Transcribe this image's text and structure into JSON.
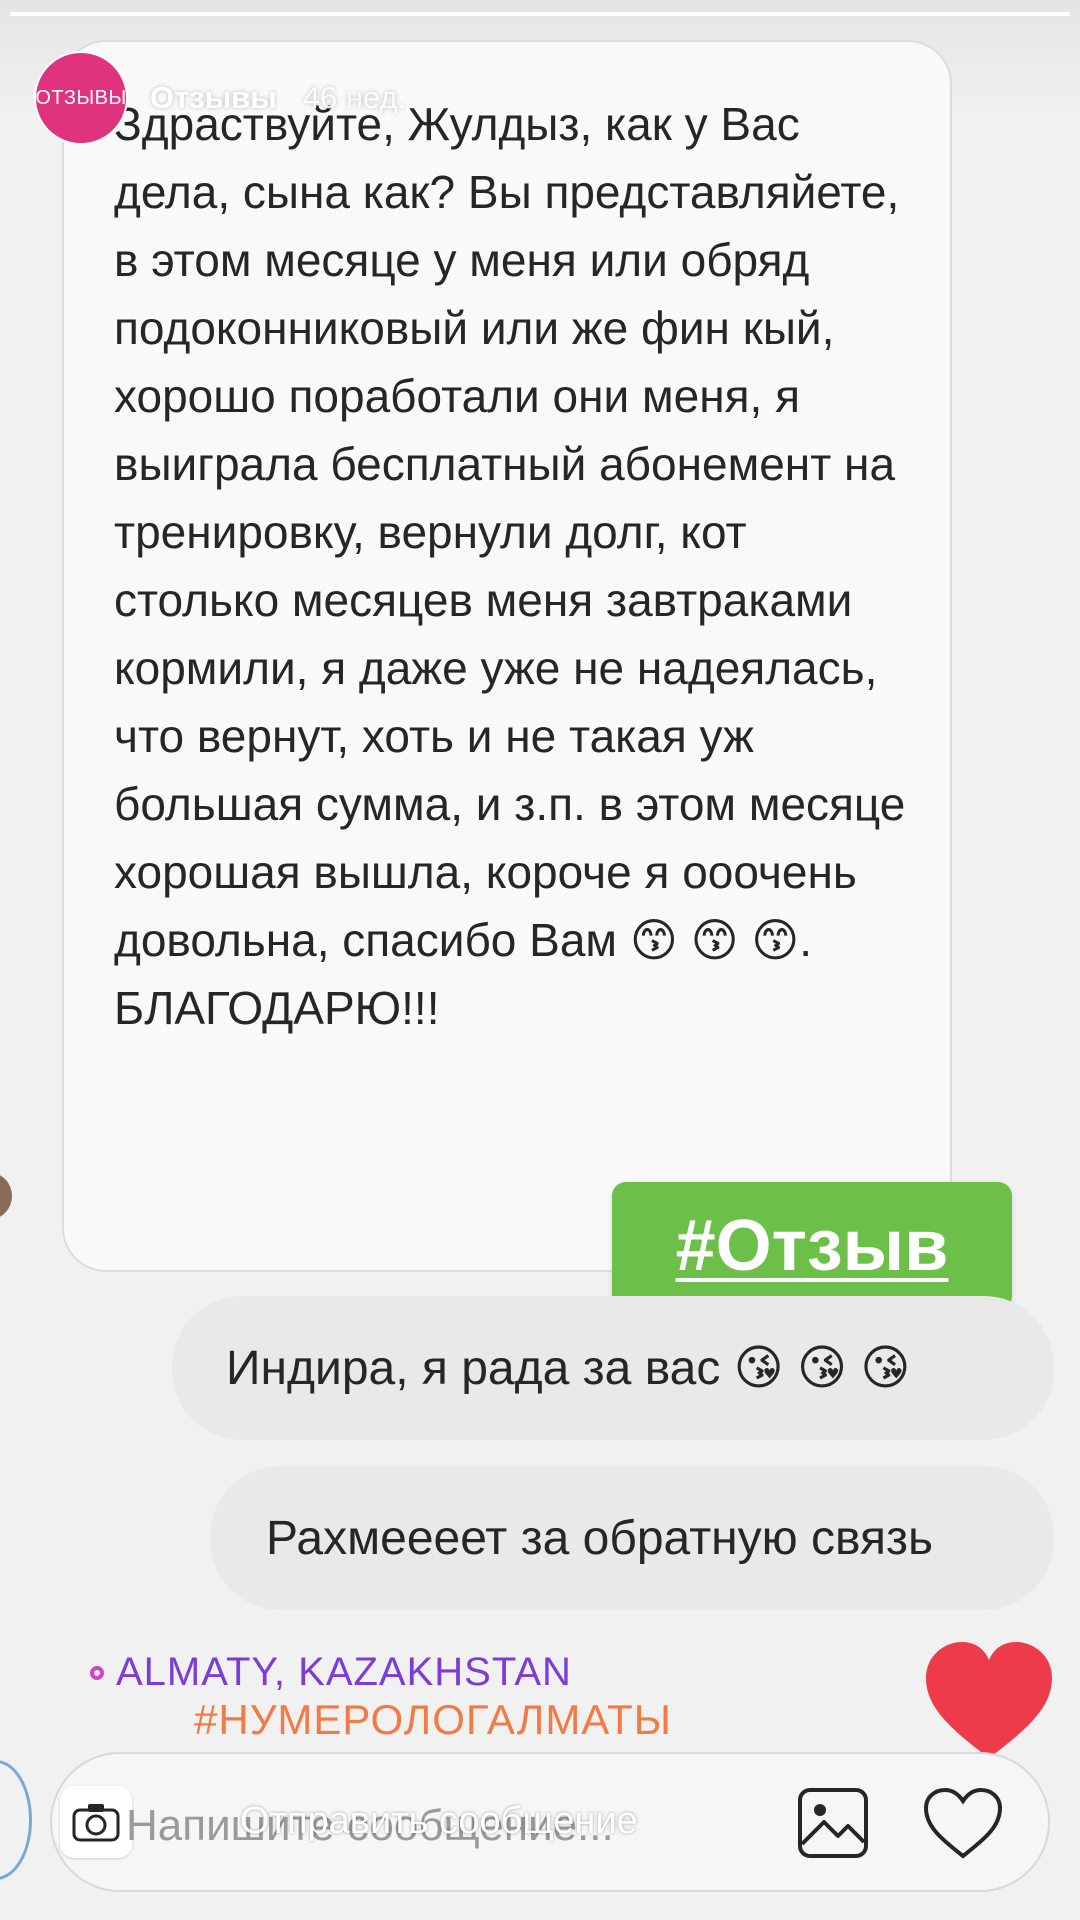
{
  "story": {
    "username": "Отзывы",
    "timestamp": "46 нед.",
    "avatar_label": "ОТЗЫВЫ",
    "progress": 1.0
  },
  "conversation": {
    "received_message": "Здраствуйте, Жулдыз, как у Вас дела, сына как? Вы представляйете, в этом месяце у меня или обряд подоконниковый или же фин кый, хорошо поработали они меня, я выиграла бесплатный абонемент на тренировку, вернули долг, кот  столько месяцев меня завтраками кормили, я даже уже не надеялась, что вернут, хоть и не такая уж большая сумма, и з.п. в этом месяце хорошая вышла, короче я ооочень довольна, спасибо Вам 😙 😙 😙. БЛАГОДАРЮ!!!",
    "sent_messages": [
      "Индира, я рада за вас 😘 😘 😘",
      "Рахмеееет за обратную связь"
    ]
  },
  "stickers": {
    "hashtag": "#Отзыв",
    "location": "ALMATY, KAZAKHSTAN",
    "caption_hashtag": "#НУМЕРОЛОГАЛМАТЫ"
  },
  "composer": {
    "placeholder": "Напишите сообщение...",
    "reply_placeholder": "Отправить сообщение"
  },
  "icons": {
    "camera": "camera-icon",
    "gallery": "gallery-icon",
    "heart": "heart-icon",
    "like": "like-heart-icon"
  },
  "colors": {
    "avatar": "#e0337e",
    "hashtag_sticker": "#6cc04a",
    "location": "#7b3dd6",
    "caption": "#f27a45",
    "like_heart": "#ee3b4b"
  }
}
